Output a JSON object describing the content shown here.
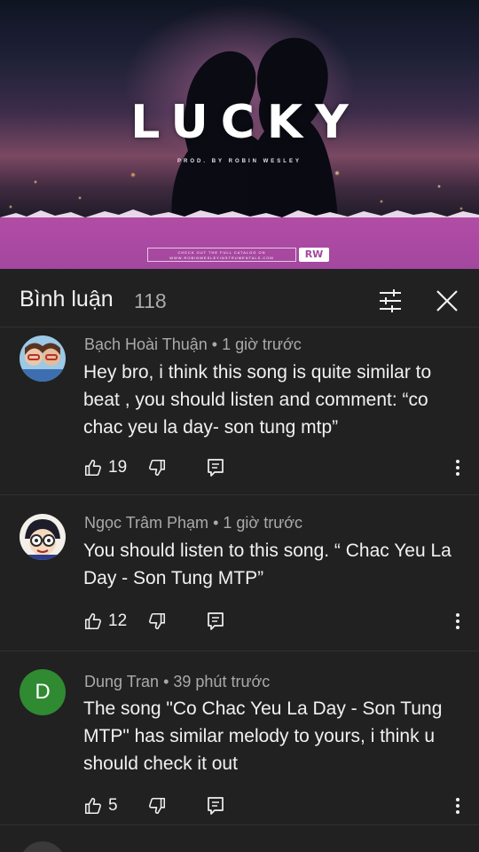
{
  "video": {
    "title": "LUCKY",
    "producer": "PROD. BY ROBIN WESLEY",
    "catalog_line1": "CHECK OUT THE FULL CATALOG ON",
    "catalog_line2": "WWW.ROBINWESLEYINSTRUMENTALS.COM",
    "logo": "RW"
  },
  "comments_panel": {
    "title": "Bình luận",
    "count": "118",
    "filter_icon": "sort-filter-icon",
    "close_icon": "close-icon"
  },
  "comments": [
    {
      "author": "Bạch Hoài Thuận",
      "time": "1 giờ trước",
      "text": "Hey bro, i think this song is quite similar to beat , you should listen and comment: “co chac yeu la day- son tung mtp”",
      "likes": "19"
    },
    {
      "author": "Ngọc Trâm Phạm",
      "time": "1 giờ trước",
      "text": "You should listen to this song. “ Chac Yeu La Day - Son Tung MTP”",
      "likes": "12"
    },
    {
      "author": "Dung Tran",
      "avatar_letter": "D",
      "time": "39 phút trước",
      "text": "The song \"Co Chac Yeu La Day - Son Tung MTP\" has similar melody to yours, i think u should check it out",
      "likes": "5"
    }
  ],
  "colors": {
    "background": "#212121",
    "text_primary": "#f1f1f1",
    "text_secondary": "#aaaaaa",
    "avatar_d": "#2f8a31",
    "banner": "#a3479f"
  }
}
